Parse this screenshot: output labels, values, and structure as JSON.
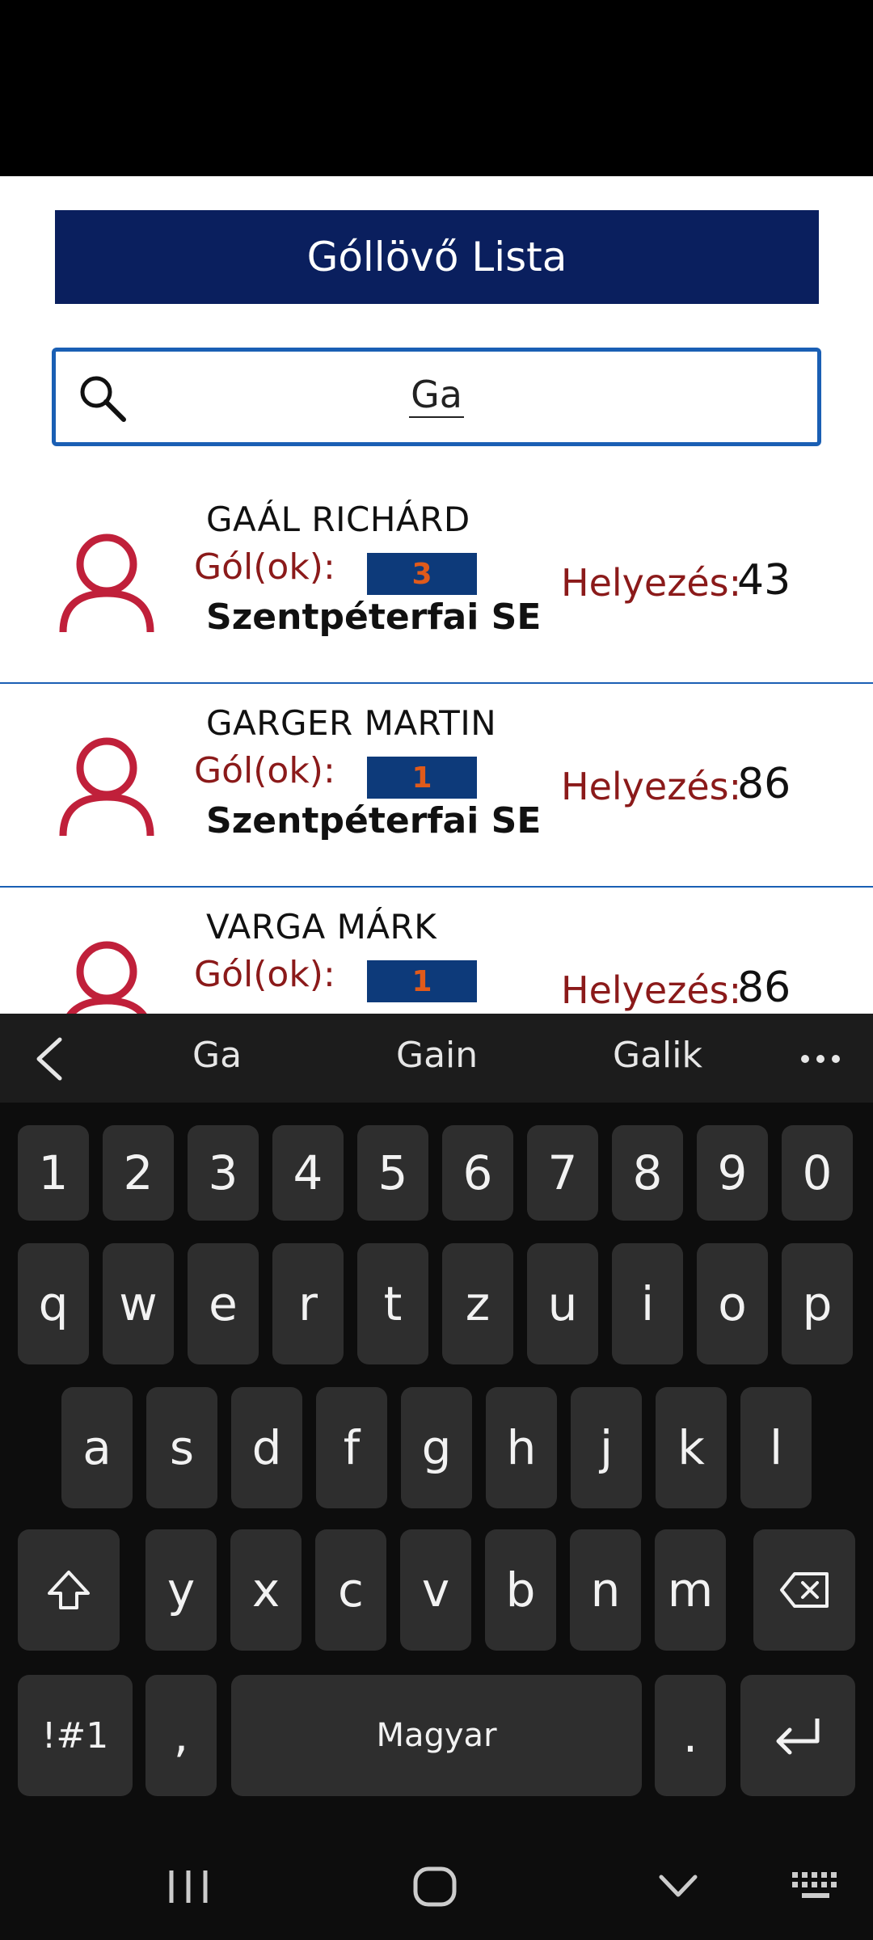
{
  "app": {
    "title": "Góllövő Lista",
    "search": {
      "value": "Ga"
    },
    "goals_label": "Gól(ok):",
    "rank_label": "Helyezés:",
    "players": [
      {
        "name": "GAÁL RICHÁRD",
        "goals": "3",
        "club": "Szentpéterfai SE",
        "rank": "43"
      },
      {
        "name": "GARGER MARTIN",
        "goals": "1",
        "club": "Szentpéterfai SE",
        "rank": "86"
      },
      {
        "name": "VARGA MÁRK",
        "goals": "1",
        "club": "",
        "rank": "86"
      }
    ]
  },
  "keyboard": {
    "suggestions": [
      "Ga",
      "Gain",
      "Galik"
    ],
    "number_row": [
      "1",
      "2",
      "3",
      "4",
      "5",
      "6",
      "7",
      "8",
      "9",
      "0"
    ],
    "row1": [
      "q",
      "w",
      "e",
      "r",
      "t",
      "z",
      "u",
      "i",
      "o",
      "p"
    ],
    "row2": [
      "a",
      "s",
      "d",
      "f",
      "g",
      "h",
      "j",
      "k",
      "l"
    ],
    "row3": [
      "y",
      "x",
      "c",
      "v",
      "b",
      "n",
      "m"
    ],
    "symbols_label": "!#1",
    "comma_label": ",",
    "space_label": "Magyar",
    "period_label": "."
  },
  "icons": {
    "search": "search-icon",
    "avatar": "person-icon",
    "shift": "shift-icon",
    "backspace": "backspace-icon",
    "enter": "enter-icon"
  },
  "colors": {
    "title_bg": "#0a1f5e",
    "accent_red": "#8b1a1a",
    "avatar_red": "#c0203a",
    "goal_box": "#0d3a7a",
    "goal_text": "#e05a1a",
    "divider": "#1a5fb4"
  }
}
